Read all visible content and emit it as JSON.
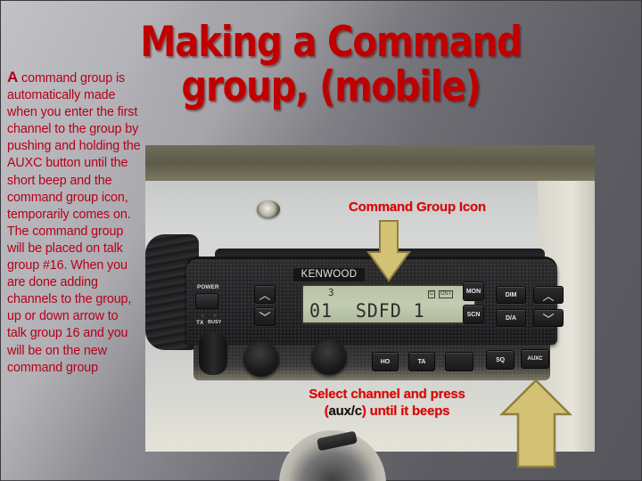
{
  "slide": {
    "title_line1": "Making a Command",
    "title_line2": "group, (mobile)",
    "body": {
      "dropcap": "A",
      "text": " command group is automatically made when you enter the first channel to the group by pushing and holding the AUXC button until the short beep and the command group icon, temporarily comes on. The command group will be placed on talk group #16. When you are done adding channels to the group, up or down arrow to talk group 16 and you will be on the new command group"
    },
    "colors": {
      "title": "#c00000",
      "body_text": "#b5001a",
      "annotation": "#e00000",
      "arrow_fill": "#d4c274",
      "arrow_stroke": "#8e7f3e"
    }
  },
  "photo": {
    "annotation_top": "Command Group Icon",
    "annotation_bottom_line1": "Select channel and press",
    "annotation_bottom_paren_open": "(",
    "annotation_bottom_key": "aux/c",
    "annotation_bottom_rest": ") until it beeps",
    "radio": {
      "brand": "KENWOOD",
      "power_label": "POWER",
      "tx_label": "TX",
      "busy_label": "BUSY",
      "lcd_top": "3",
      "lcd_main": "01  SDFD 1",
      "lcd_indicator_c": "C",
      "lcd_indicator_ost": "OST",
      "keys_left": [
        {
          "name": "up-arrow",
          "glyph": "︿"
        },
        {
          "name": "down-arrow",
          "glyph": "﹀"
        }
      ],
      "keys_right": [
        "MON",
        "SCN",
        "DIM",
        "D/A"
      ],
      "keys_right_arrows": [
        {
          "name": "up-arrow",
          "glyph": "︿"
        },
        {
          "name": "down-arrow",
          "glyph": "﹀"
        }
      ],
      "keys_bottom": [
        "HO",
        "TA",
        "",
        "SQ",
        "AUXC"
      ]
    }
  }
}
